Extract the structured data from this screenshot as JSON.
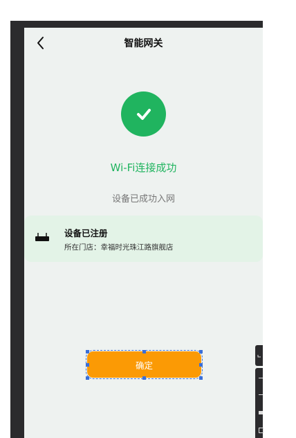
{
  "header": {
    "title": "智能网关",
    "back_icon": "chevron-left-icon"
  },
  "status": {
    "icon": "check-circle-icon",
    "success_text": "Wi-Fi连接成功",
    "sub_text": "设备已成功入网",
    "color": "#20b45f"
  },
  "card": {
    "icon": "router-icon",
    "title": "设备已注册",
    "store_label": "所在门店：",
    "store_name": "幸福时光珠江路旗舰店"
  },
  "actions": {
    "confirm_label": "确定",
    "accent": "#fb9a05"
  }
}
